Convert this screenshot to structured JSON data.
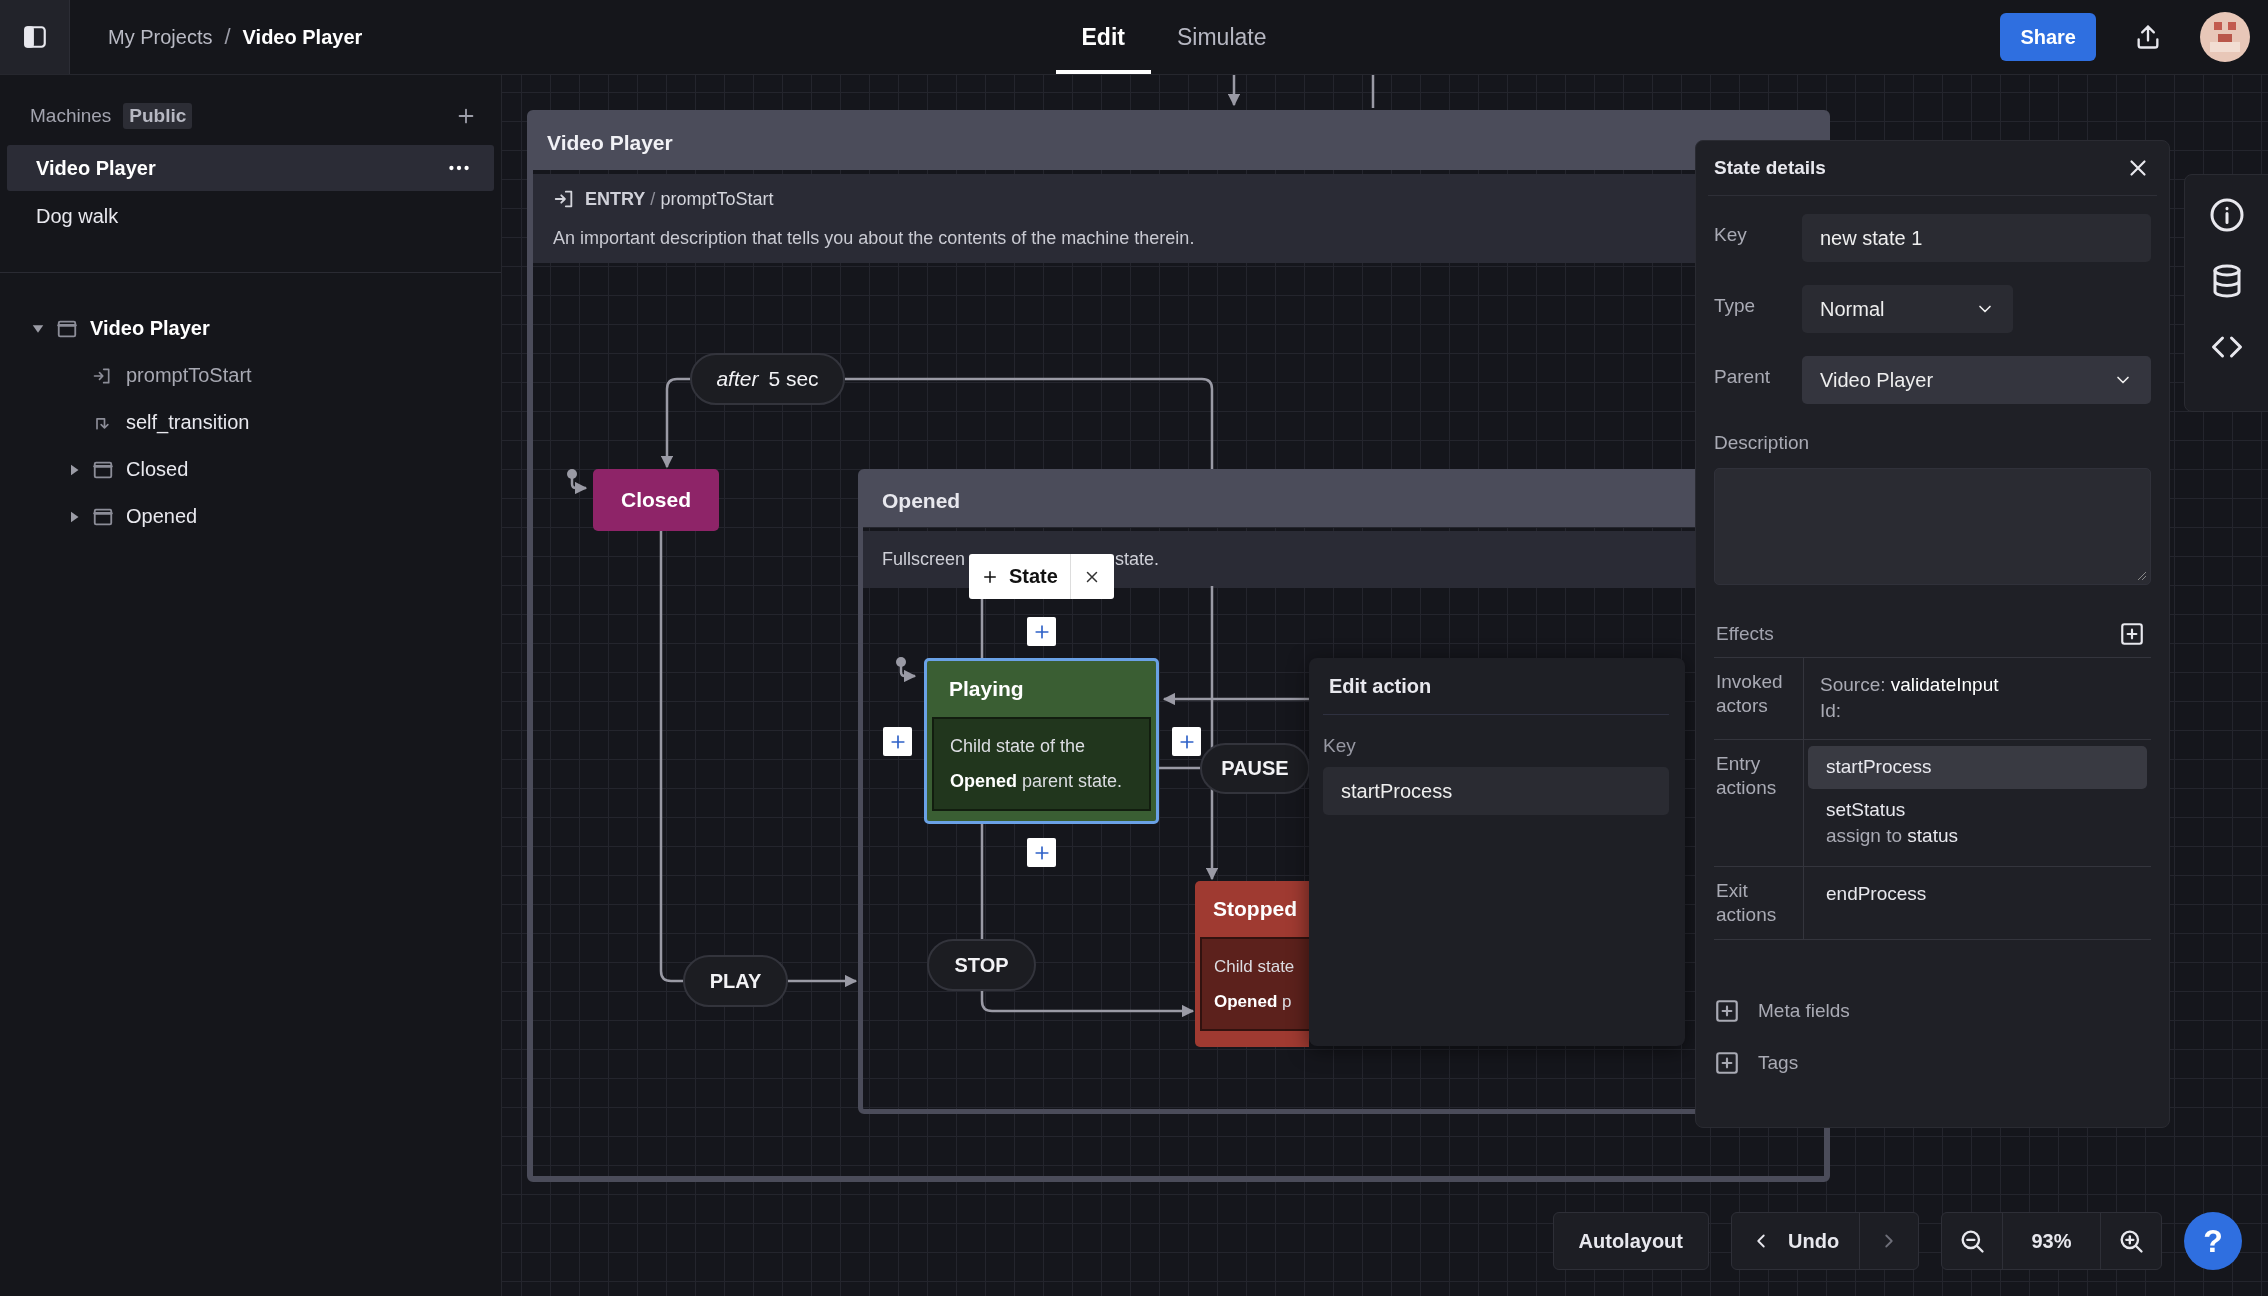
{
  "topbar": {
    "breadcrumb": [
      "My Projects",
      "Video Player"
    ],
    "separator": "/",
    "tabs": [
      {
        "label": "Edit",
        "selected": true
      },
      {
        "label": "Simulate",
        "selected": false
      }
    ],
    "share": "Share"
  },
  "sidebar": {
    "heading": "Machines",
    "badge": "Public",
    "machines": [
      {
        "label": "Video Player",
        "selected": true
      },
      {
        "label": "Dog walk",
        "selected": false
      }
    ],
    "tree": [
      {
        "label": "Video Player",
        "kind": "state",
        "expanded": true,
        "children": [
          {
            "label": "promptToStart",
            "kind": "entry"
          },
          {
            "label": "self_transition",
            "kind": "transition"
          },
          {
            "label": "Closed",
            "kind": "state",
            "expanded": false
          },
          {
            "label": "Opened",
            "kind": "state",
            "expanded": false
          }
        ]
      }
    ]
  },
  "canvas": {
    "machine": {
      "title": "Video Player",
      "entry_keyword": "ENTRY",
      "entry_separator": "/",
      "entry_action": "promptToStart",
      "description": "An important description that tells you about the contents of the machine therein."
    },
    "delayed_event": {
      "keyword": "after",
      "delay": "5 sec"
    },
    "parent_state": {
      "title": "Opened",
      "description_parts": [
        "Fullscreen",
        "state."
      ]
    },
    "state_toolbar": {
      "label": "State"
    },
    "states": [
      {
        "title": "Closed",
        "color": "#8e2468",
        "selected": false
      },
      {
        "title": "Playing",
        "color": "#3a5e33",
        "selected": true,
        "lines": [
          "Child state of the",
          "**Opened** parent state."
        ]
      },
      {
        "title": "Stopped",
        "color": "#9f3a31",
        "selected": false,
        "lines": [
          "Child state",
          "**Opened** p"
        ]
      }
    ],
    "events": [
      {
        "label": "PLAY"
      },
      {
        "label": "PAUSE"
      },
      {
        "label": "STOP"
      }
    ],
    "edit_action": {
      "title": "Edit action",
      "key_label": "Key",
      "key_value": "startProcess"
    }
  },
  "details": {
    "title": "State details",
    "fields": [
      {
        "label": "Key",
        "kind": "text",
        "value": "new state 1"
      },
      {
        "label": "Type",
        "kind": "select",
        "value": "Normal"
      },
      {
        "label": "Parent",
        "kind": "select",
        "value": "Video Player"
      }
    ],
    "description_label": "Description",
    "effects": {
      "title": "Effects",
      "rows": [
        {
          "label": "Invoked actors",
          "kind": "actor",
          "source_label": "Source:",
          "source": "validateInput",
          "id_label": "Id:"
        },
        {
          "label": "Entry actions",
          "kind": "actions",
          "items": [
            {
              "name": "startProcess",
              "selected": true
            },
            {
              "name": "setStatus",
              "selected": false,
              "detail_prefix": "assign to",
              "detail": "status"
            }
          ]
        },
        {
          "label": "Exit actions",
          "kind": "actions",
          "items": [
            {
              "name": "endProcess",
              "selected": false
            }
          ]
        }
      ]
    },
    "extras": [
      "Meta fields",
      "Tags"
    ]
  },
  "controls": {
    "autolayout": "Autolayout",
    "undo": "Undo",
    "zoom": "93%",
    "help": "?"
  }
}
